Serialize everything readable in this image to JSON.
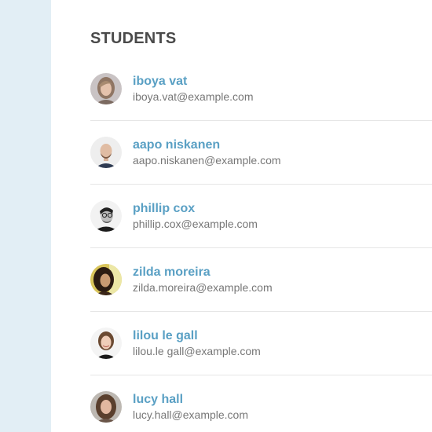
{
  "page": {
    "title": "STUDENTS"
  },
  "colors": {
    "sidebar": "#e2eef5",
    "name_link": "#5aa0c4",
    "email_text": "#777777",
    "title_text": "#4a4a4a",
    "divider": "#e6e6e6"
  },
  "students": [
    {
      "name": "iboya vat",
      "email": "iboya.vat@example.com",
      "avatar": "avatar-photo-woman-light-hair"
    },
    {
      "name": "aapo niskanen",
      "email": "aapo.niskanen@example.com",
      "avatar": "avatar-photo-man-bald-beard"
    },
    {
      "name": "phillip cox",
      "email": "phillip.cox@example.com",
      "avatar": "avatar-photo-man-glasses-bw"
    },
    {
      "name": "zilda moreira",
      "email": "zilda.moreira@example.com",
      "avatar": "avatar-photo-woman-dark-hair"
    },
    {
      "name": "lilou le gall",
      "email": "lilou.le gall@example.com",
      "avatar": "avatar-photo-woman-smiling"
    },
    {
      "name": "lucy hall",
      "email": "lucy.hall@example.com",
      "avatar": "avatar-photo-woman-brown-hair"
    }
  ]
}
